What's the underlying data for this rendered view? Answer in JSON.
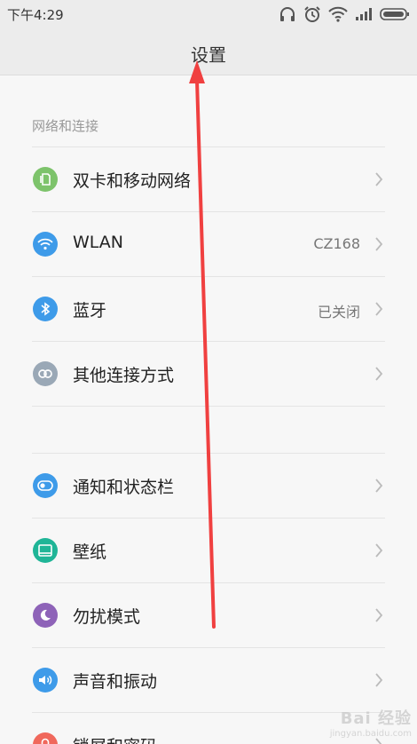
{
  "status_bar": {
    "time": "下午4:29",
    "icons": [
      "headphones-icon",
      "alarm-icon",
      "wifi-icon",
      "signal-icon",
      "battery-icon"
    ]
  },
  "title": "设置",
  "sections": [
    {
      "header": "网络和连接",
      "items": [
        {
          "label": "双卡和移动网络",
          "value": "",
          "icon": "sim-card-icon",
          "color": "#7dc36b"
        },
        {
          "label": "WLAN",
          "value": "CZ168",
          "icon": "wifi-icon",
          "color": "#3e9be9"
        },
        {
          "label": "蓝牙",
          "value": "已关闭",
          "icon": "bluetooth-icon",
          "color": "#3e9be9"
        },
        {
          "label": "其他连接方式",
          "value": "",
          "icon": "link-icon",
          "color": "#9aa8b6"
        }
      ]
    },
    {
      "header": "",
      "items": [
        {
          "label": "通知和状态栏",
          "value": "",
          "icon": "toggle-icon",
          "color": "#3e9be9"
        },
        {
          "label": "壁纸",
          "value": "",
          "icon": "wallpaper-icon",
          "color": "#1fb597"
        },
        {
          "label": "勿扰模式",
          "value": "",
          "icon": "moon-icon",
          "color": "#8e63b8"
        },
        {
          "label": "声音和振动",
          "value": "",
          "icon": "speaker-icon",
          "color": "#3e9be9"
        },
        {
          "label": "锁屏和密码",
          "value": "",
          "icon": "lock-icon",
          "color": "#f0685c"
        }
      ]
    }
  ],
  "watermark": {
    "logo": "Bai 经验",
    "url": "jingyan.baidu.com"
  },
  "annotation_color": "#f04040"
}
